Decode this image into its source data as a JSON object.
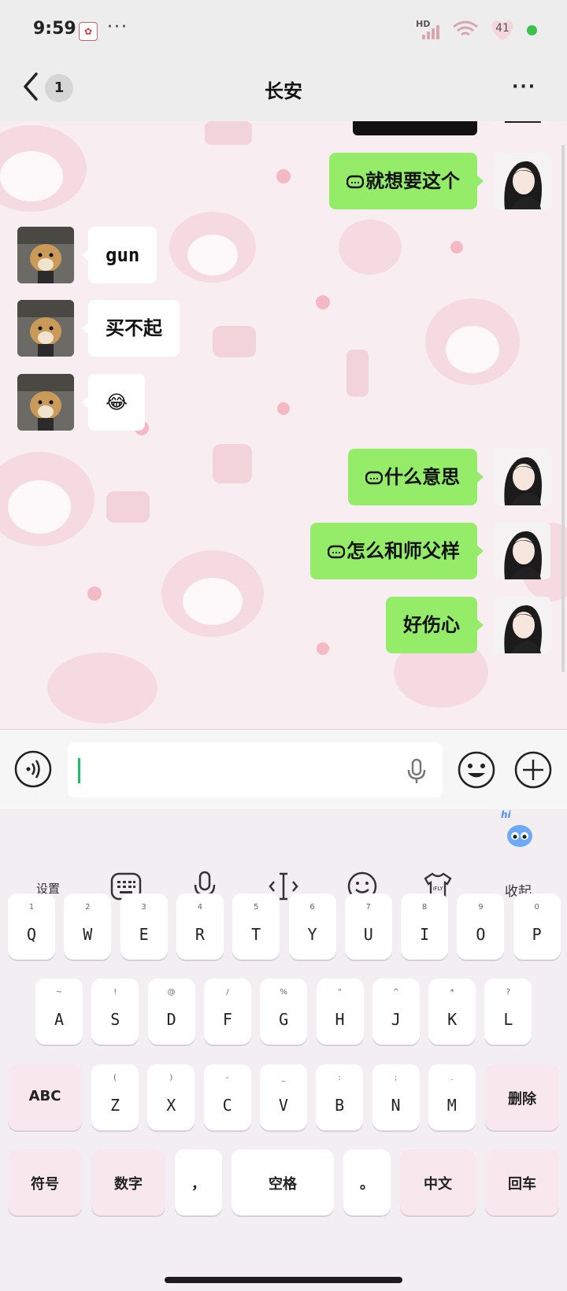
{
  "status": {
    "time": "9:59",
    "network": "HD",
    "battery": "41",
    "more": "···"
  },
  "nav": {
    "unread": "1",
    "title": "长安",
    "more": "···"
  },
  "messages": [
    {
      "side": "out",
      "text": "就想要这个"
    },
    {
      "side": "in",
      "text": "gun"
    },
    {
      "side": "in",
      "text": "买不起"
    },
    {
      "side": "in",
      "text": "😂"
    },
    {
      "side": "out",
      "text": "什么意思"
    },
    {
      "side": "out",
      "text": "怎么和师父样"
    },
    {
      "side": "out",
      "text": "好伤心"
    }
  ],
  "input": {
    "value": ""
  },
  "keyboard": {
    "hi": "hi",
    "settings": "设置",
    "collapse": "收起",
    "row1": [
      {
        "k": "Q",
        "s": "1"
      },
      {
        "k": "W",
        "s": "2"
      },
      {
        "k": "E",
        "s": "3"
      },
      {
        "k": "R",
        "s": "4"
      },
      {
        "k": "T",
        "s": "5"
      },
      {
        "k": "Y",
        "s": "6"
      },
      {
        "k": "U",
        "s": "7"
      },
      {
        "k": "I",
        "s": "8"
      },
      {
        "k": "O",
        "s": "9"
      },
      {
        "k": "P",
        "s": "0"
      }
    ],
    "row2": [
      {
        "k": "A",
        "s": "~"
      },
      {
        "k": "S",
        "s": "!"
      },
      {
        "k": "D",
        "s": "@"
      },
      {
        "k": "F",
        "s": "/"
      },
      {
        "k": "G",
        "s": "%"
      },
      {
        "k": "H",
        "s": "\""
      },
      {
        "k": "J",
        "s": "^"
      },
      {
        "k": "K",
        "s": "*"
      },
      {
        "k": "L",
        "s": "?"
      }
    ],
    "row3": [
      {
        "k": "Z",
        "s": "("
      },
      {
        "k": "X",
        "s": ")"
      },
      {
        "k": "C",
        "s": "-"
      },
      {
        "k": "V",
        "s": "_"
      },
      {
        "k": "B",
        "s": ":"
      },
      {
        "k": "N",
        "s": ";"
      },
      {
        "k": "M",
        "s": "."
      }
    ],
    "abc": "ABC",
    "delete": "删除",
    "symbols": "符号",
    "numbers": "数字",
    "comma": "，",
    "space": "空格",
    "period": "。",
    "chinese": "中文",
    "enter": "回车"
  }
}
